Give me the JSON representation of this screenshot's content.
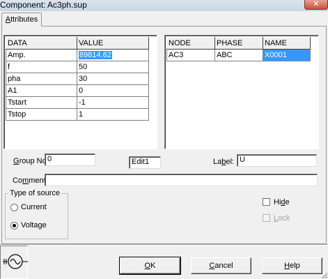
{
  "window": {
    "title": "Component: Ac3ph.sup",
    "close_icon": "close-icon"
  },
  "tabs": [
    {
      "label_underlined": "A",
      "label_rest": "ttributes"
    }
  ],
  "data_table": {
    "headers": [
      "DATA",
      "VALUE"
    ],
    "rows": [
      {
        "name": "Amp.",
        "value": "89814.62",
        "selected": true
      },
      {
        "name": "f",
        "value": "50"
      },
      {
        "name": "pha",
        "value": "30"
      },
      {
        "name": "A1",
        "value": "0"
      },
      {
        "name": "Tstart",
        "value": "-1"
      },
      {
        "name": "Tstop",
        "value": "1"
      }
    ]
  },
  "node_table": {
    "headers": [
      "NODE",
      "PHASE",
      "NAME"
    ],
    "rows": [
      {
        "node": "AC3",
        "phase": "ABC",
        "name": "X0001",
        "selected": true
      }
    ]
  },
  "group_no": {
    "label_underlined": "G",
    "label_rest": "roup No:",
    "value": "0"
  },
  "edit1": {
    "value": "Edit1"
  },
  "label_field": {
    "label_pre": "La",
    "label_underlined": "b",
    "label_post": "el:",
    "value": "U"
  },
  "comment": {
    "label_pre": "Co",
    "label_underlined": "m",
    "label_post": "ment:",
    "value": ""
  },
  "type_of_source": {
    "legend": "Type of source",
    "options": [
      {
        "label": "Current",
        "checked": false
      },
      {
        "label": "Voltage",
        "checked": true
      }
    ]
  },
  "checkboxes": {
    "hide": {
      "label_pre": "Hi",
      "label_underlined": "d",
      "label_post": "e",
      "checked": false,
      "enabled": true
    },
    "lock": {
      "label_pre": "",
      "label_underlined": "L",
      "label_post": "ock",
      "checked": false,
      "enabled": false
    }
  },
  "buttons": {
    "ok": {
      "label_underlined": "O",
      "label_rest": "K"
    },
    "cancel": {
      "label_underlined": "C",
      "label_rest": "ancel"
    },
    "help": {
      "label_underlined": "H",
      "label_rest": "elp"
    }
  },
  "symbol": {
    "icon": "ac-source-symbol-icon"
  },
  "colors": {
    "selection": "#3399ff",
    "dialog_bg": "#f0f0f0"
  }
}
